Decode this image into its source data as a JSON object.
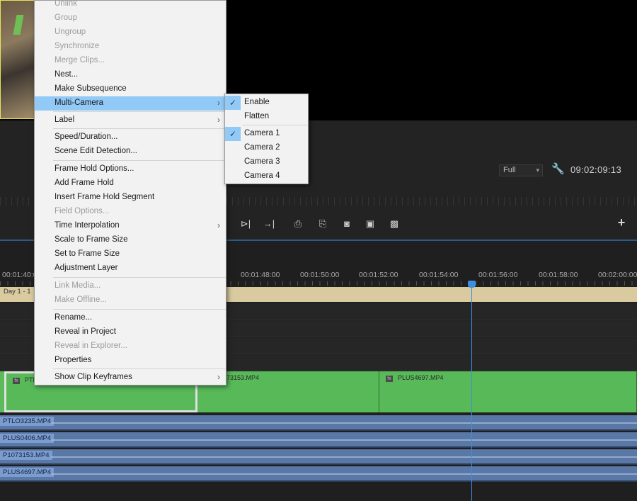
{
  "monitor": {
    "zoom": "Full",
    "timecode": "09:02:09:13",
    "icons": [
      "wrench-icon",
      "step-forward-icon",
      "go-to-out-icon",
      "lift-icon",
      "extract-icon",
      "camera-icon",
      "insert-icon",
      "overwrite-icon",
      "plus-icon"
    ],
    "transport_glyphs": {
      "step_forward": "⊳|",
      "go_to_out": "→|",
      "lift": "⎙",
      "extract": "⎘",
      "camera": "◙",
      "insert": "▣",
      "overwrite": "▩",
      "plus": "+"
    }
  },
  "timeline": {
    "ruler_labels": [
      "00:01:40:0",
      "00:01:48:00",
      "00:01:50:00",
      "00:01:52:00",
      "00:01:54:00",
      "00:01:56:00",
      "00:01:58:00",
      "00:02:00:00"
    ],
    "sequence_label": "Day 1 - 1",
    "video_clips": [
      {
        "name": "PTL"
      },
      {
        "name": "073153.MP4"
      },
      {
        "name": "PLUS4697.MP4"
      }
    ],
    "fx_glyph": "fx",
    "audio_tracks": [
      {
        "name": "PTLO3235.MP4"
      },
      {
        "name": "PLUS0406.MP4"
      },
      {
        "name": "P1073153.MP4"
      },
      {
        "name": "PLUS4697.MP4"
      }
    ],
    "playhead_color": "#3d8ee0"
  },
  "context_menu": {
    "items": [
      {
        "label": "Unlink",
        "disabled": true
      },
      {
        "label": "Group",
        "disabled": true
      },
      {
        "label": "Ungroup",
        "disabled": true
      },
      {
        "label": "Synchronize",
        "disabled": true
      },
      {
        "label": "Merge Clips...",
        "disabled": true
      },
      {
        "label": "Nest...",
        "disabled": false
      },
      {
        "label": "Make Subsequence",
        "disabled": false
      },
      {
        "label": "Multi-Camera",
        "disabled": false,
        "submenu": true,
        "highlighted": true
      },
      {
        "label": "Label",
        "disabled": false,
        "submenu": true
      },
      {
        "label": "Speed/Duration...",
        "disabled": false
      },
      {
        "label": "Scene Edit Detection...",
        "disabled": false
      },
      {
        "label": "Frame Hold Options...",
        "disabled": false
      },
      {
        "label": "Add Frame Hold",
        "disabled": false
      },
      {
        "label": "Insert Frame Hold Segment",
        "disabled": false
      },
      {
        "label": "Field Options...",
        "disabled": true
      },
      {
        "label": "Time Interpolation",
        "disabled": false,
        "submenu": true
      },
      {
        "label": "Scale to Frame Size",
        "disabled": false
      },
      {
        "label": "Set to Frame Size",
        "disabled": false
      },
      {
        "label": "Adjustment Layer",
        "disabled": false
      },
      {
        "label": "Link Media...",
        "disabled": true
      },
      {
        "label": "Make Offline...",
        "disabled": true
      },
      {
        "label": "Rename...",
        "disabled": false
      },
      {
        "label": "Reveal in Project",
        "disabled": false
      },
      {
        "label": "Reveal in Explorer...",
        "disabled": true
      },
      {
        "label": "Properties",
        "disabled": false
      },
      {
        "label": "Show Clip Keyframes",
        "disabled": false,
        "submenu": true
      }
    ],
    "submenu_arrow": "›"
  },
  "multicam_submenu": {
    "items": [
      {
        "label": "Enable",
        "checked": true
      },
      {
        "label": "Flatten",
        "checked": false
      },
      {
        "label": "Camera 1",
        "checked": true
      },
      {
        "label": "Camera 2",
        "checked": false
      },
      {
        "label": "Camera 3",
        "checked": false
      },
      {
        "label": "Camera 4",
        "checked": false
      }
    ],
    "check_glyph": "✓"
  }
}
